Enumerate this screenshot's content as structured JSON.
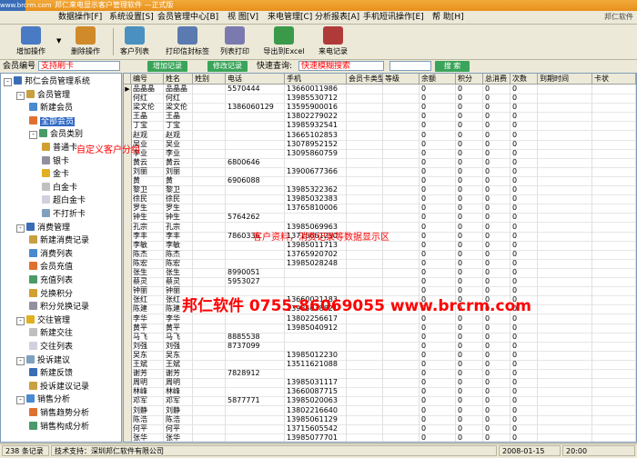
{
  "titlebar": {
    "logo": "www.brcrm.com",
    "title": "邦仁来电显示客户管理软件 —正式版"
  },
  "menu": [
    "数据操作[F]",
    "系统设置[S]",
    "会员管理中心[B]",
    "视 图[V]",
    "来电管理[C]",
    "分析报表[A]",
    "手机短讯操作[E]",
    "帮 助[H]"
  ],
  "menu_right": "邦仁软件",
  "toolbar": [
    {
      "label": "增加操作",
      "icon": "add-member-icon",
      "color": "#4a7ac4"
    },
    {
      "label": "删除操作",
      "icon": "delete-member-icon",
      "color": "#d08a2a"
    },
    {
      "label": "客户列表",
      "icon": "customer-list-icon",
      "color": "#4a90c0"
    },
    {
      "label": "打印信封标签",
      "icon": "envelope-print-icon",
      "color": "#5a7ab0"
    },
    {
      "label": "列表打印",
      "icon": "list-print-icon",
      "color": "#7a7ab0"
    },
    {
      "label": "导出到Excel",
      "icon": "excel-export-icon",
      "color": "#3a9a4a"
    },
    {
      "label": "来电记录",
      "icon": "call-record-icon",
      "color": "#b03a3a"
    }
  ],
  "search": {
    "member_label": "会员编号",
    "member_placeholder": "支持刷卡",
    "add_btn": "增加记录",
    "modify_btn": "修改记录",
    "quick_label": "快速查询:",
    "quick_value": "快速模糊搜索",
    "search_btn": "搜 索"
  },
  "tree": [
    {
      "label": "邦仁会员管理系统",
      "icon": "system-icon",
      "depth": 0,
      "toggle": "-"
    },
    {
      "label": "会员管理",
      "icon": "member-folder-icon",
      "depth": 1,
      "toggle": "-"
    },
    {
      "label": "新建会员",
      "icon": "new-member-icon",
      "depth": 2
    },
    {
      "label": "全部会员",
      "icon": "all-members-icon",
      "depth": 2,
      "selected": true
    },
    {
      "label": "会员类别",
      "icon": "member-category-icon",
      "depth": 2,
      "toggle": "-"
    },
    {
      "label": "普通卡",
      "icon": "card-icon",
      "depth": 3
    },
    {
      "label": "银卡",
      "icon": "card-icon",
      "depth": 3
    },
    {
      "label": "金卡",
      "icon": "card-icon",
      "depth": 3
    },
    {
      "label": "白金卡",
      "icon": "card-icon",
      "depth": 3
    },
    {
      "label": "超白金卡",
      "icon": "card-icon",
      "depth": 3
    },
    {
      "label": "不打折卡",
      "icon": "card-icon",
      "depth": 3
    },
    {
      "label": "消费管理",
      "icon": "consume-folder-icon",
      "depth": 1,
      "toggle": "-"
    },
    {
      "label": "新建消费记录",
      "icon": "new-consume-icon",
      "depth": 2
    },
    {
      "label": "消费列表",
      "icon": "consume-list-icon",
      "depth": 2
    },
    {
      "label": "会员充值",
      "icon": "recharge-icon",
      "depth": 2
    },
    {
      "label": "充值列表",
      "icon": "recharge-list-icon",
      "depth": 2
    },
    {
      "label": "兑换积分",
      "icon": "points-icon",
      "depth": 2
    },
    {
      "label": "积分兑换记录",
      "icon": "points-record-icon",
      "depth": 2
    },
    {
      "label": "交往管理",
      "icon": "contact-folder-icon",
      "depth": 1,
      "toggle": "-"
    },
    {
      "label": "新建交往",
      "icon": "new-contact-icon",
      "depth": 2
    },
    {
      "label": "交往列表",
      "icon": "contact-list-icon",
      "depth": 2
    },
    {
      "label": "投诉建议",
      "icon": "complaint-folder-icon",
      "depth": 1,
      "toggle": "-"
    },
    {
      "label": "新建反馈",
      "icon": "new-feedback-icon",
      "depth": 2
    },
    {
      "label": "投诉建议记录",
      "icon": "complaint-list-icon",
      "depth": 2
    },
    {
      "label": "销售分析",
      "icon": "sales-folder-icon",
      "depth": 1,
      "toggle": "-"
    },
    {
      "label": "销售趋势分析",
      "icon": "trend-icon",
      "depth": 2
    },
    {
      "label": "销售构成分析",
      "icon": "composition-icon",
      "depth": 2
    }
  ],
  "columns": [
    "编号",
    "姓名",
    "姓别",
    "电话",
    "手机",
    "会员卡类型",
    "等级",
    "余额",
    "积分",
    "总消费",
    "次数",
    "到期时间",
    "卡状"
  ],
  "rows": [
    [
      "品晶晶",
      "品晶晶",
      "",
      "5570444",
      "13660011986",
      "",
      "",
      "0",
      "0",
      "0",
      "0",
      "",
      ""
    ],
    [
      "何红",
      "何红",
      "",
      "",
      "13985530712",
      "",
      "",
      "0",
      "0",
      "0",
      "0",
      "",
      ""
    ],
    [
      "梁文伦",
      "梁文伦",
      "",
      "1386060129",
      "13595900016",
      "",
      "",
      "0",
      "0",
      "0",
      "0",
      "",
      ""
    ],
    [
      "王晶",
      "王晶",
      "",
      "",
      "13802279022",
      "",
      "",
      "0",
      "0",
      "0",
      "0",
      "",
      ""
    ],
    [
      "丁宝",
      "丁宝",
      "",
      "",
      "13985932541",
      "",
      "",
      "0",
      "0",
      "0",
      "0",
      "",
      ""
    ],
    [
      "赵观",
      "赵观",
      "",
      "",
      "13665102853",
      "",
      "",
      "0",
      "0",
      "0",
      "0",
      "",
      ""
    ],
    [
      "吴业",
      "吴业",
      "",
      "",
      "13078952152",
      "",
      "",
      "0",
      "0",
      "0",
      "0",
      "",
      ""
    ],
    [
      "李业",
      "李业",
      "",
      "",
      "13095860759",
      "",
      "",
      "0",
      "0",
      "0",
      "0",
      "",
      ""
    ],
    [
      "黄云",
      "黄云",
      "",
      "6800646",
      "",
      "",
      "",
      "0",
      "0",
      "0",
      "0",
      "",
      ""
    ],
    [
      "刘丽",
      "刘丽",
      "",
      "",
      "13900677366",
      "",
      "",
      "0",
      "0",
      "0",
      "0",
      "",
      ""
    ],
    [
      "黄",
      "黄",
      "",
      "6906088",
      "",
      "",
      "",
      "0",
      "0",
      "0",
      "0",
      "",
      ""
    ],
    [
      "黎卫",
      "黎卫",
      "",
      "",
      "13985322362",
      "",
      "",
      "0",
      "0",
      "0",
      "0",
      "",
      ""
    ],
    [
      "徐民",
      "徐民",
      "",
      "",
      "13985032383",
      "",
      "",
      "0",
      "0",
      "0",
      "0",
      "",
      ""
    ],
    [
      "罗生",
      "罗生",
      "",
      "",
      "13765810006",
      "",
      "",
      "0",
      "0",
      "0",
      "0",
      "",
      ""
    ],
    [
      "钟生",
      "钟生",
      "",
      "5764262",
      "",
      "",
      "",
      "0",
      "0",
      "0",
      "0",
      "",
      ""
    ],
    [
      "孔宗",
      "孔宗",
      "",
      "",
      "13985069963",
      "",
      "",
      "0",
      "0",
      "0",
      "0",
      "",
      ""
    ],
    [
      "李丰",
      "李丰",
      "",
      "7860336",
      "13715661250",
      "",
      "",
      "0",
      "0",
      "0",
      "0",
      "",
      ""
    ],
    [
      "李敏",
      "李敏",
      "",
      "",
      "13985011713",
      "",
      "",
      "0",
      "0",
      "0",
      "0",
      "",
      ""
    ],
    [
      "陈杰",
      "陈杰",
      "",
      "",
      "13765920702",
      "",
      "",
      "0",
      "0",
      "0",
      "0",
      "",
      ""
    ],
    [
      "陈宏",
      "陈宏",
      "",
      "",
      "13985028248",
      "",
      "",
      "0",
      "0",
      "0",
      "0",
      "",
      ""
    ],
    [
      "张生",
      "张生",
      "",
      "8990051",
      "",
      "",
      "",
      "0",
      "0",
      "0",
      "0",
      "",
      ""
    ],
    [
      "蔡灵",
      "蔡灵",
      "",
      "5953027",
      "",
      "",
      "",
      "0",
      "0",
      "0",
      "0",
      "",
      ""
    ],
    [
      "钟丽",
      "钟丽",
      "",
      "",
      "",
      "",
      "",
      "0",
      "0",
      "0",
      "0",
      "",
      ""
    ],
    [
      "张红",
      "张红",
      "",
      "",
      "13660021183",
      "",
      "",
      "0",
      "0",
      "0",
      "0",
      "",
      ""
    ],
    [
      "陈建",
      "陈建",
      "",
      "",
      "13985038821",
      "",
      "",
      "0",
      "0",
      "0",
      "0",
      "",
      ""
    ],
    [
      "李华",
      "李华",
      "",
      "",
      "13802256617",
      "",
      "",
      "0",
      "0",
      "0",
      "0",
      "",
      ""
    ],
    [
      "黄平",
      "黄平",
      "",
      "",
      "13985040912",
      "",
      "",
      "0",
      "0",
      "0",
      "0",
      "",
      ""
    ],
    [
      "马飞",
      "马飞",
      "",
      "8885538",
      "",
      "",
      "",
      "0",
      "0",
      "0",
      "0",
      "",
      ""
    ],
    [
      "刘强",
      "刘强",
      "",
      "8737099",
      "",
      "",
      "",
      "0",
      "0",
      "0",
      "0",
      "",
      ""
    ],
    [
      "吴东",
      "吴东",
      "",
      "",
      "13985012230",
      "",
      "",
      "0",
      "0",
      "0",
      "0",
      "",
      ""
    ],
    [
      "王斌",
      "王斌",
      "",
      "",
      "13511621088",
      "",
      "",
      "0",
      "0",
      "0",
      "0",
      "",
      ""
    ],
    [
      "谢芳",
      "谢芳",
      "",
      "7828912",
      "",
      "",
      "",
      "0",
      "0",
      "0",
      "0",
      "",
      ""
    ],
    [
      "周明",
      "周明",
      "",
      "",
      "13985031117",
      "",
      "",
      "0",
      "0",
      "0",
      "0",
      "",
      ""
    ],
    [
      "林峰",
      "林峰",
      "",
      "",
      "13660087715",
      "",
      "",
      "0",
      "0",
      "0",
      "0",
      "",
      ""
    ],
    [
      "邓军",
      "邓军",
      "",
      "5877771",
      "13985020063",
      "",
      "",
      "0",
      "0",
      "0",
      "0",
      "",
      ""
    ],
    [
      "刘静",
      "刘静",
      "",
      "",
      "13802216640",
      "",
      "",
      "0",
      "0",
      "0",
      "0",
      "",
      ""
    ],
    [
      "陈浩",
      "陈浩",
      "",
      "",
      "13985061129",
      "",
      "",
      "0",
      "0",
      "0",
      "0",
      "",
      ""
    ],
    [
      "何平",
      "何平",
      "",
      "",
      "13715605542",
      "",
      "",
      "0",
      "0",
      "0",
      "0",
      "",
      ""
    ],
    [
      "张华",
      "张华",
      "",
      "",
      "13985077701",
      "",
      "",
      "0",
      "0",
      "0",
      "0",
      "",
      ""
    ]
  ],
  "overlays": {
    "custom_group": "自定义客户分组",
    "data_area": "客户资料，消费记录等数据显示区",
    "brand": "邦仁软件 0755-86069055 www.brcrm.com"
  },
  "status": {
    "count": "238 条记录",
    "support": "技术支持：深圳邦仁软件有限公司",
    "date": "2008-01-15",
    "time": "20:00"
  }
}
